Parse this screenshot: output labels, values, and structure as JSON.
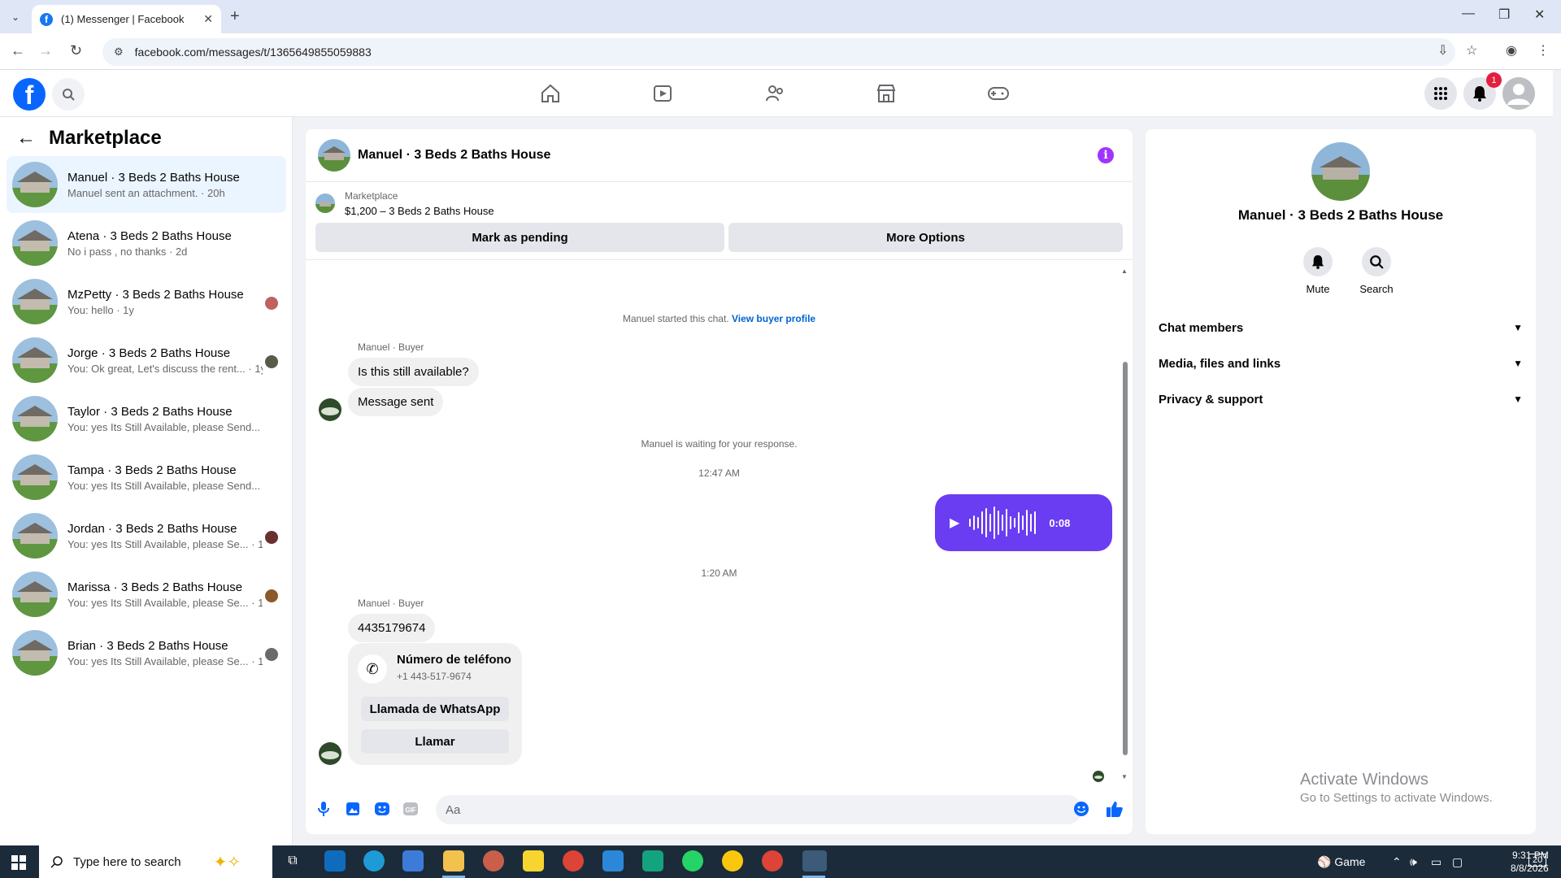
{
  "browser": {
    "tab_title": "(1) Messenger | Facebook",
    "url": "facebook.com/messages/t/1365649855059883"
  },
  "header": {
    "notification_count": "1"
  },
  "left": {
    "title": "Marketplace",
    "conversations": [
      {
        "name": "Manuel · 3 Beds 2 Baths House",
        "sub": "Manuel sent an attachment. · 20h",
        "active": true
      },
      {
        "name": "Atena · 3 Beds 2 Baths House",
        "sub": "No i pass , no thanks · 2d"
      },
      {
        "name": "MzPetty · 3 Beds 2 Baths House",
        "sub": "You: hello · 1y"
      },
      {
        "name": "Jorge · 3 Beds 2 Baths House",
        "sub": "You: Ok great, Let's discuss the rent... · 1y"
      },
      {
        "name": "Taylor · 3 Beds 2 Baths House",
        "sub": "You: yes Its Still Available, please Send... · 1y"
      },
      {
        "name": "Tampa · 3 Beds 2 Baths House",
        "sub": "You: yes Its Still Available, please Send... · 1y"
      },
      {
        "name": "Jordan · 3 Beds 2 Baths House",
        "sub": "You: yes Its Still Available, please Se... · 1y"
      },
      {
        "name": "Marissa · 3 Beds 2 Baths House",
        "sub": "You: yes Its Still Available, please Se... · 1y"
      },
      {
        "name": "Brian · 3 Beds 2 Baths House",
        "sub": "You: yes Its Still Available, please Se... · 1y"
      }
    ]
  },
  "chat": {
    "title": "Manuel · 3 Beds 2 Baths House",
    "marketplace_label": "Marketplace",
    "listing": "$1,200 – 3 Beds 2 Baths House",
    "mark_pending": "Mark as pending",
    "more_options": "More Options",
    "started_text": "Manuel started this chat.",
    "view_profile": "View buyer profile",
    "sender_label": "Manuel · Buyer",
    "msg1": "Is this still available?",
    "msg2": "Message sent",
    "waiting_text": "Manuel is waiting for your response.",
    "time1": "12:47 AM",
    "voice_duration": "0:08",
    "time2": "1:20 AM",
    "phone_msg": "4435179674",
    "contact_title": "Número de teléfono",
    "contact_number": "+1 443-517-9674",
    "whatsapp_btn": "Llamada de WhatsApp",
    "call_btn": "Llamar",
    "input_placeholder": "Aa"
  },
  "right": {
    "name": "Manuel · 3 Beds 2 Baths House",
    "mute": "Mute",
    "search": "Search",
    "rows": [
      "Chat members",
      "Media, files and links",
      "Privacy & support"
    ]
  },
  "watermark": {
    "line1": "Activate Windows",
    "line2": "Go to Settings to activate Windows."
  },
  "taskbar": {
    "search_placeholder": "Type here to search",
    "game_label": "Game",
    "time": "9:31 PM",
    "date": "8/8/2026",
    "notif_count": "20"
  }
}
